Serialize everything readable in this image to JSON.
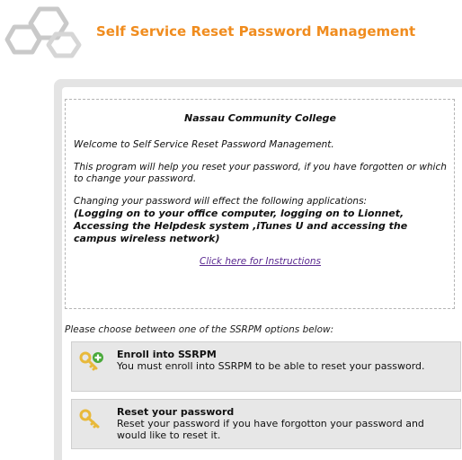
{
  "header": {
    "logo_icon": "hexagon-outline-logo",
    "title": "Self Service Reset Password Management"
  },
  "info": {
    "college": "Nassau Community College",
    "welcome": "Welcome to Self Service Reset Password Management.",
    "program": "This program will help you reset your password, if you have forgotten or which to change your password.",
    "changing": "Changing your password will effect the following applications:",
    "applications": "(Logging on to your office computer, logging on to Lionnet, Accessing the Helpdesk system ,iTunes U and accessing the campus wireless network)",
    "instructions_link": "Click here for Instructions"
  },
  "choose_prompt": "Please choose between one of the SSRPM options below:",
  "options": [
    {
      "icon": "key-plus-icon",
      "title": "Enroll into SSRPM",
      "description": "You must enroll into SSRPM to be able to reset your password."
    },
    {
      "icon": "key-icon",
      "title": "Reset your password",
      "description": "Reset your password if you have forgotton your password and would like to reset it."
    }
  ],
  "colors": {
    "title": "#f08c1e",
    "link": "#5b2a91",
    "panel": "#e4e4e4",
    "option_bg": "#e7e7e7",
    "key": "#e8b93a",
    "plus": "#49a93a"
  }
}
